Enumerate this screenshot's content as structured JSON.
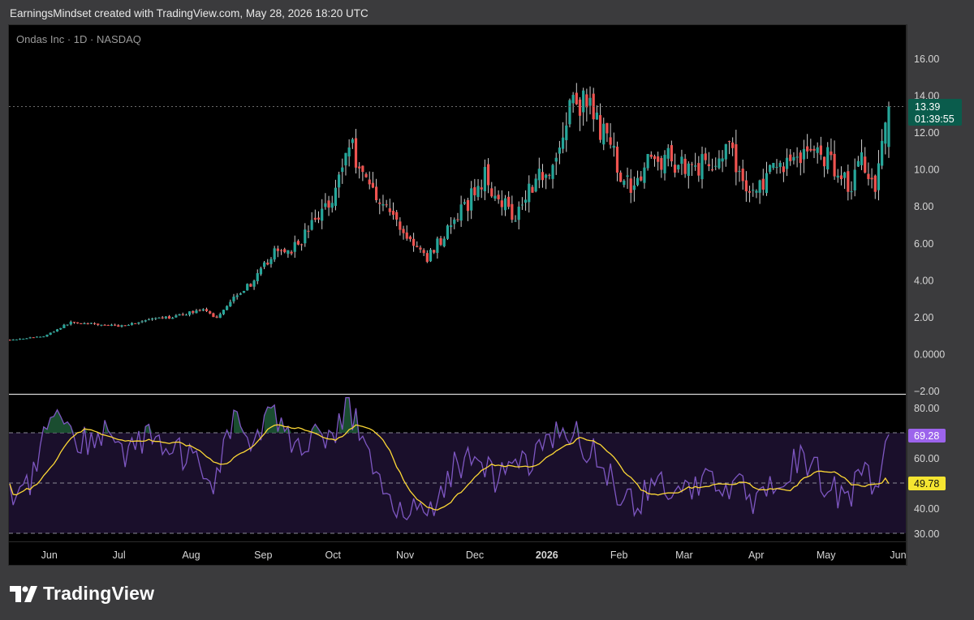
{
  "header": {
    "credit": "EarningsMindset created with TradingView.com, May 28, 2026 18:20 UTC"
  },
  "symbol": {
    "label": "Ondas Inc · 1D · NASDAQ"
  },
  "brand": {
    "name": "TradingView"
  },
  "price_axis": {
    "ticks": [
      "16.00",
      "14.00",
      "12.00",
      "10.00",
      "8.00",
      "6.00",
      "4.00",
      "2.00",
      "0.0000",
      "−2.00"
    ]
  },
  "rsi_axis": {
    "ticks": [
      "80.00",
      "70.00",
      "60.00",
      "50.00",
      "40.00",
      "30.00"
    ]
  },
  "time_axis": {
    "ticks": [
      "Jun",
      "Jul",
      "Aug",
      "Sep",
      "Oct",
      "Nov",
      "Dec",
      "2026",
      "Feb",
      "Mar",
      "Apr",
      "May",
      "Jun"
    ]
  },
  "last_price": {
    "value": "13.39",
    "countdown": "01:39:55"
  },
  "rsi_badges": {
    "rsi": "69.28",
    "ma": "49.78"
  },
  "colors": {
    "up": "#26a69a",
    "down": "#ef5350",
    "rsi": "#7e57c2",
    "rsi_ma": "#fdd835",
    "badge_price": "#0a5c4c",
    "badge_rsi": "#9c64ec",
    "badge_ma": "#f5e531"
  },
  "chart_data": [
    {
      "type": "candlestick",
      "title": "Ondas Inc · 1D · NASDAQ",
      "ylim": [
        -2,
        17.5
      ],
      "x_start": "2025-05-15",
      "x_end": "2026-05-28",
      "last_close": 13.39,
      "path": [
        [
          "2025-05-15",
          0.75
        ],
        [
          "2025-05-30",
          0.95
        ],
        [
          "2025-06-10",
          1.7
        ],
        [
          "2025-06-20",
          1.6
        ],
        [
          "2025-07-01",
          1.5
        ],
        [
          "2025-07-15",
          1.85
        ],
        [
          "2025-07-25",
          2.0
        ],
        [
          "2025-08-05",
          2.4
        ],
        [
          "2025-08-12",
          1.95
        ],
        [
          "2025-08-20",
          3.2
        ],
        [
          "2025-08-28",
          3.9
        ],
        [
          "2025-09-05",
          5.4
        ],
        [
          "2025-09-15",
          5.8
        ],
        [
          "2025-09-25",
          7.5
        ],
        [
          "2025-10-02",
          8.9
        ],
        [
          "2025-10-08",
          11.5
        ],
        [
          "2025-10-15",
          9.5
        ],
        [
          "2025-10-22",
          8.3
        ],
        [
          "2025-11-01",
          6.5
        ],
        [
          "2025-11-10",
          5.1
        ],
        [
          "2025-11-15",
          6.0
        ],
        [
          "2025-11-25",
          7.6
        ],
        [
          "2025-12-05",
          9.6
        ],
        [
          "2025-12-10",
          8.8
        ],
        [
          "2025-12-18",
          7.5
        ],
        [
          "2025-12-25",
          9.2
        ],
        [
          "2026-01-05",
          10.5
        ],
        [
          "2026-01-12",
          13.8
        ],
        [
          "2026-01-20",
          13.2
        ],
        [
          "2026-01-28",
          11.2
        ],
        [
          "2026-02-05",
          9.0
        ],
        [
          "2026-02-12",
          10.2
        ],
        [
          "2026-02-20",
          10.6
        ],
        [
          "2026-03-01",
          10.3
        ],
        [
          "2026-03-10",
          10.2
        ],
        [
          "2026-03-20",
          11.0
        ],
        [
          "2026-03-30",
          8.6
        ],
        [
          "2026-04-08",
          9.8
        ],
        [
          "2026-04-18",
          10.8
        ],
        [
          "2026-04-28",
          11.0
        ],
        [
          "2026-05-05",
          10.2
        ],
        [
          "2026-05-12",
          9.0
        ],
        [
          "2026-05-16",
          10.8
        ],
        [
          "2026-05-22",
          9.2
        ],
        [
          "2026-05-28",
          13.39
        ]
      ]
    },
    {
      "type": "line",
      "title": "RSI",
      "ylim": [
        27,
        84
      ],
      "levels": [
        70,
        50,
        30
      ],
      "series": [
        {
          "name": "RSI",
          "last": 69.28
        },
        {
          "name": "RSI MA",
          "last": 49.78
        }
      ],
      "path": [
        [
          "2025-05-15",
          45
        ],
        [
          "2025-05-25",
          52
        ],
        [
          "2025-06-03",
          82
        ],
        [
          "2025-06-12",
          63
        ],
        [
          "2025-06-25",
          72
        ],
        [
          "2025-07-05",
          60
        ],
        [
          "2025-07-15",
          70
        ],
        [
          "2025-07-25",
          62
        ],
        [
          "2025-08-02",
          58
        ],
        [
          "2025-08-10",
          50
        ],
        [
          "2025-08-20",
          78
        ],
        [
          "2025-08-28",
          63
        ],
        [
          "2025-09-05",
          78
        ],
        [
          "2025-09-15",
          65
        ],
        [
          "2025-09-25",
          72
        ],
        [
          "2025-10-02",
          68
        ],
        [
          "2025-10-08",
          82
        ],
        [
          "2025-10-15",
          62
        ],
        [
          "2025-10-22",
          45
        ],
        [
          "2025-11-01",
          42
        ],
        [
          "2025-11-10",
          35
        ],
        [
          "2025-11-20",
          55
        ],
        [
          "2025-12-01",
          60
        ],
        [
          "2025-12-10",
          52
        ],
        [
          "2025-12-20",
          55
        ],
        [
          "2025-12-28",
          60
        ],
        [
          "2026-01-07",
          72
        ],
        [
          "2026-01-15",
          68
        ],
        [
          "2026-01-25",
          57
        ],
        [
          "2026-02-05",
          40
        ],
        [
          "2026-02-15",
          48
        ],
        [
          "2026-02-25",
          50
        ],
        [
          "2026-03-05",
          46
        ],
        [
          "2026-03-15",
          52
        ],
        [
          "2026-03-25",
          48
        ],
        [
          "2026-04-01",
          40
        ],
        [
          "2026-04-10",
          50
        ],
        [
          "2026-04-20",
          60
        ],
        [
          "2026-05-01",
          50
        ],
        [
          "2026-05-10",
          44
        ],
        [
          "2026-05-18",
          55
        ],
        [
          "2026-05-23",
          46
        ],
        [
          "2026-05-28",
          69.28
        ]
      ]
    }
  ]
}
